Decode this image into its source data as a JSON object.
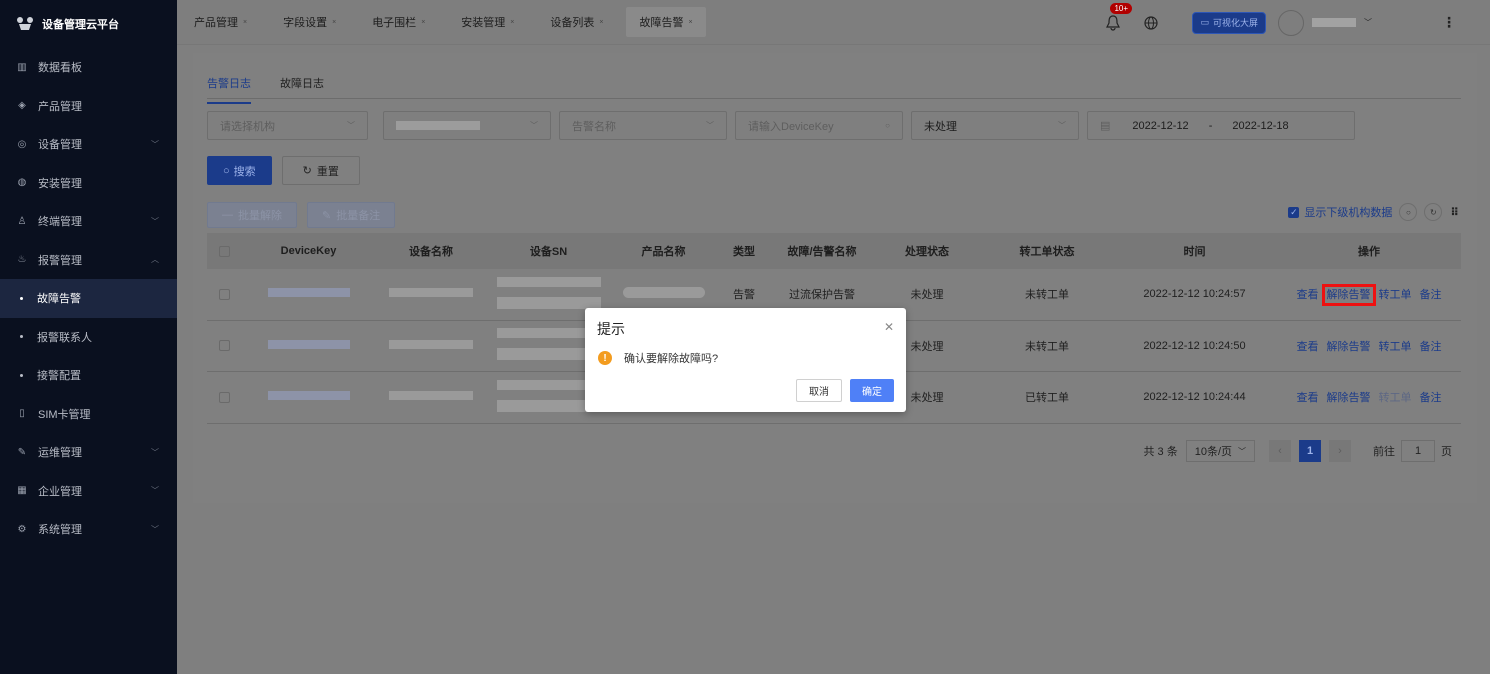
{
  "app": {
    "title": "设备管理云平台"
  },
  "sidebar": {
    "items": [
      {
        "label": "数据看板",
        "icon": "chart-icon",
        "arrow": ""
      },
      {
        "label": "产品管理",
        "icon": "cube-icon",
        "arrow": ""
      },
      {
        "label": "设备管理",
        "icon": "device-icon",
        "arrow": "﹀"
      },
      {
        "label": "安装管理",
        "icon": "install-icon",
        "arrow": ""
      },
      {
        "label": "终端管理",
        "icon": "person-icon",
        "arrow": "﹀"
      },
      {
        "label": "报警管理",
        "icon": "alarm-icon",
        "arrow": "︿"
      },
      {
        "label": "故障告警",
        "sub": true,
        "active": true
      },
      {
        "label": "报警联系人",
        "sub": true
      },
      {
        "label": "接警配置",
        "sub": true
      },
      {
        "label": "SIM卡管理",
        "icon": "sim-icon",
        "arrow": ""
      },
      {
        "label": "运维管理",
        "icon": "ops-icon",
        "arrow": "﹀"
      },
      {
        "label": "企业管理",
        "icon": "company-icon",
        "arrow": "﹀"
      },
      {
        "label": "系统管理",
        "icon": "settings-icon",
        "arrow": "﹀"
      }
    ]
  },
  "header": {
    "tabs": [
      "产品管理",
      "字段设置",
      "电子围栏",
      "安装管理",
      "设备列表",
      "故障告警"
    ],
    "tab_close": "×",
    "bell_badge": "10+",
    "bigscreen_label": "可视化大屏",
    "user_arrow": "﹀",
    "more": "⋮"
  },
  "tabs": {
    "alarm_log": "告警日志",
    "fault_log": "故障日志"
  },
  "filters": {
    "org_placeholder": "请选择机构",
    "alarm_name_placeholder": "告警名称",
    "devicekey_placeholder": "请输入DeviceKey",
    "status_value": "未处理",
    "date_start": "2022-12-12",
    "date_sep": "-",
    "date_end": "2022-12-18",
    "caret": "﹀"
  },
  "buttons": {
    "search": "搜索",
    "reset": "重置",
    "batch_release": "批量解除",
    "batch_note": "批量备注"
  },
  "toolbar": {
    "show_sub_org": "显示下级机构数据"
  },
  "table": {
    "headers": [
      "DeviceKey",
      "设备名称",
      "设备SN",
      "产品名称",
      "类型",
      "故障/告警名称",
      "处理状态",
      "转工单状态",
      "时间",
      "操作"
    ],
    "rows": [
      {
        "type": "告警",
        "fault": "过流保护告警",
        "state": "未处理",
        "order": "未转工单",
        "time": "2022-12-12 10:24:57"
      },
      {
        "type": "",
        "fault": "",
        "state": "未处理",
        "order": "未转工单",
        "time": "2022-12-12 10:24:50"
      },
      {
        "type": "",
        "fault": "",
        "state": "未处理",
        "order": "已转工单",
        "time": "2022-12-12 10:24:44"
      }
    ],
    "ops": {
      "view": "查看",
      "release": "解除告警",
      "transfer": "转工单",
      "note": "备注"
    }
  },
  "pager": {
    "total": "共 3 条",
    "size": "10条/页",
    "current": "1",
    "goto": "前往",
    "goto_value": "1",
    "page": "页"
  },
  "dialog": {
    "title": "提示",
    "message": "确认要解除故障吗?",
    "cancel": "取消",
    "confirm": "确定"
  },
  "colors": {
    "primary": "#1b3b8a",
    "confirm": "#4f80f7",
    "warning": "#f39c1f",
    "highlight": "#e11111"
  }
}
